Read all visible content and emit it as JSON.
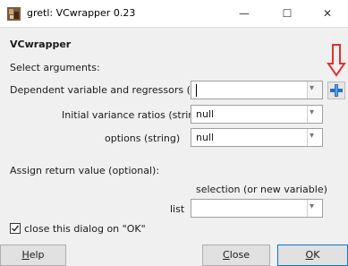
{
  "window": {
    "title": "gretl: VCwrapper 0.23",
    "minimize_glyph": "—",
    "maximize_glyph": "☐",
    "close_glyph": "✕"
  },
  "dialog": {
    "heading": "VCwrapper",
    "select_arguments_label": "Select arguments:",
    "arguments": [
      {
        "label": "Dependent variable and regressors (list)",
        "value": ""
      },
      {
        "label": "Initial variance ratios (string)",
        "value": "null"
      },
      {
        "label": "options (string)",
        "value": "null"
      }
    ],
    "assign_return_label": "Assign return value (optional):",
    "selection_header": "selection (or new variable)",
    "return_list_label": "list",
    "return_list_value": "",
    "close_on_ok_label": "close this dialog on \"OK\"",
    "close_on_ok_checked": true
  },
  "buttons": {
    "help": {
      "first": "H",
      "rest": "elp"
    },
    "close": {
      "first": "C",
      "rest": "lose"
    },
    "ok": {
      "first": "O",
      "rest": "K"
    }
  },
  "icons": {
    "app": "gretl-app-icon",
    "add": "add-list-icon",
    "annotation": "red-down-arrow-icon"
  },
  "colors": {
    "accent": "#0078d7",
    "annotation_arrow": "#e03030",
    "add_icon": "#2a6fbf"
  }
}
